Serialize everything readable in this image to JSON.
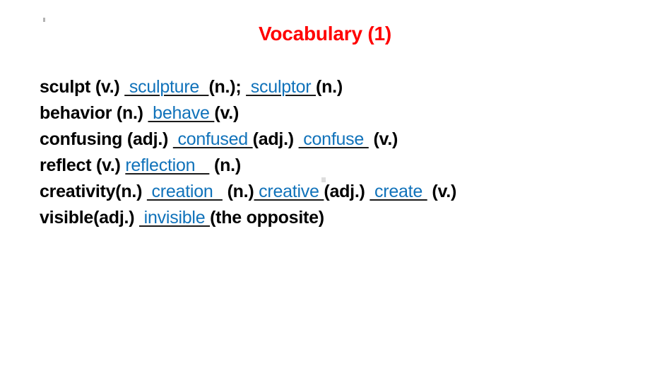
{
  "slide": {
    "background_color": "#ffffff",
    "title": "Vocabulary (1)",
    "title_color": "#ff0000",
    "answer_color": "#1072ba",
    "prompt_color": "#000000",
    "underline_color": "#1a1a1a"
  },
  "vocab": {
    "lines": [
      {
        "id": "line-sculpt",
        "segments": [
          {
            "kind": "prompt",
            "text": "sculpt (v.) "
          },
          {
            "kind": "answer",
            "text": " sculpture  "
          },
          {
            "kind": "tail",
            "text": "(n.); "
          },
          {
            "kind": "answer",
            "text": " sculptor "
          },
          {
            "kind": "tail",
            "text": "(n.)"
          }
        ]
      },
      {
        "id": "line-behavior",
        "segments": [
          {
            "kind": "prompt",
            "text": "behavior (n.) "
          },
          {
            "kind": "answer",
            "text": " behave "
          },
          {
            "kind": "tail",
            "text": "(v.)"
          }
        ]
      },
      {
        "id": "line-confusing",
        "segments": [
          {
            "kind": "prompt",
            "text": "confusing (adj.) "
          },
          {
            "kind": "answer",
            "text": " confused "
          },
          {
            "kind": "tail",
            "text": "(adj.) "
          },
          {
            "kind": "answer",
            "text": " confuse "
          },
          {
            "kind": "tail",
            "text": " (v.)"
          }
        ]
      },
      {
        "id": "line-reflect",
        "segments": [
          {
            "kind": "prompt",
            "text": "reflect (v.) "
          },
          {
            "kind": "answer",
            "text": "reflection   "
          },
          {
            "kind": "tail",
            "text": " (n.)"
          }
        ]
      },
      {
        "id": "line-creativity",
        "segments": [
          {
            "kind": "prompt",
            "text": "creativity(n.) "
          },
          {
            "kind": "answer",
            "text": " creation  "
          },
          {
            "kind": "tail",
            "text": " (n.)"
          },
          {
            "kind": "answer",
            "text": " creative "
          },
          {
            "kind": "tail",
            "text": "(adj.) "
          },
          {
            "kind": "answer",
            "text": " create "
          },
          {
            "kind": "tail",
            "text": " (v.)"
          }
        ]
      },
      {
        "id": "line-visible",
        "segments": [
          {
            "kind": "prompt",
            "text": "visible(adj.) "
          },
          {
            "kind": "answer",
            "text": " invisible "
          },
          {
            "kind": "tail",
            "text": "(the opposite)"
          }
        ]
      }
    ]
  }
}
